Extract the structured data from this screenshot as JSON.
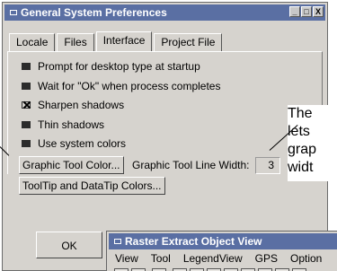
{
  "window": {
    "title": "General System Preferences",
    "title_buttons": [
      "_",
      "□",
      "X"
    ]
  },
  "tabs": [
    {
      "label": "Locale",
      "active": false
    },
    {
      "label": "Files",
      "active": false
    },
    {
      "label": "Interface",
      "active": true
    },
    {
      "label": "Project File",
      "active": false
    }
  ],
  "options": [
    {
      "label": "Prompt for desktop type at startup",
      "checked": false
    },
    {
      "label": "Wait for \"Ok\" when process completes",
      "checked": false
    },
    {
      "label": "Sharpen shadows",
      "checked": true
    },
    {
      "label": "Thin shadows",
      "checked": false
    },
    {
      "label": "Use system colors",
      "checked": false
    }
  ],
  "graphic_tool_button": "Graphic Tool Color...",
  "line_width_label": "Graphic Tool Line Width:",
  "line_width_value": "3",
  "tooltip_button": "ToolTip and DataTip Colors...",
  "ok_button": "OK",
  "callout": {
    "lines": [
      "The",
      "lets",
      "grap",
      "widt"
    ]
  },
  "raster_window": {
    "title": "Raster Extract Object View",
    "menu": [
      "View",
      "Tool",
      "LegendView",
      "GPS",
      "Option"
    ],
    "tools": [
      "select-icon",
      "select2-icon",
      "arrow-icon",
      "pan-icon",
      "zoom-fit-icon",
      "zoom-in-icon",
      "zoom-out-icon",
      "zoom-box-icon",
      "zoom-grid-icon",
      "zoom-reset-icon",
      "measure-icon"
    ]
  }
}
